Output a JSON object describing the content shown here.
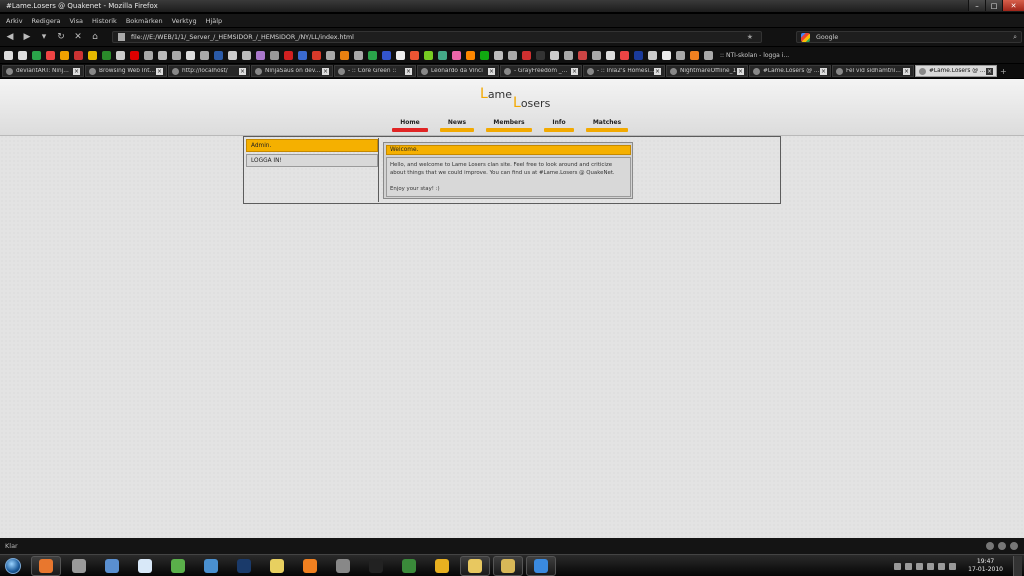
{
  "window": {
    "title": "#Lame.Losers @ Quakenet - Mozilla Firefox"
  },
  "menu": [
    "Arkiv",
    "Redigera",
    "Visa",
    "Historik",
    "Bokmärken",
    "Verktyg",
    "Hjälp"
  ],
  "navbar": {
    "url": "file:///E:/WEB/1/1/_Server_/_HEMSIDOR_/_HEMSIDOR_/NY/LL/index.html",
    "search_placeholder": "Google"
  },
  "bookmarks": {
    "colors": [
      "#ddd",
      "#ddd",
      "#2aa44a",
      "#e44",
      "#f0a000",
      "#c33",
      "#e6b800",
      "#2a8a2a",
      "#ccc",
      "#d00",
      "#aaa",
      "#bbb",
      "#aaa",
      "#ddd",
      "#aaa",
      "#2a5aa8",
      "#ccc",
      "#bbb",
      "#a7c",
      "#999",
      "#d02020",
      "#3a6ad0",
      "#d83a2a",
      "#aaa",
      "#e88010",
      "#aaa",
      "#2aa44a",
      "#3355cc",
      "#eee",
      "#e53",
      "#7c2",
      "#4a8",
      "#e6a",
      "#f80",
      "#1a1",
      "#bbb",
      "#aaa",
      "#d03030",
      "#333",
      "#ccc",
      "#aaa",
      "#c44",
      "#aaa",
      "#ddd",
      "#ee4444",
      "#1a3a9a",
      "#ccc",
      "#eee",
      "#aaa",
      "#f08020",
      "#aaa"
    ],
    "last_label": ":: NTI-skolan - logga i..."
  },
  "tabs": [
    {
      "label": "deviantART: Ninj...",
      "active": false
    },
    {
      "label": "Browsing Web Int...",
      "active": false
    },
    {
      "label": "http://localhost/",
      "active": false
    },
    {
      "label": "NinjaSaus on dev...",
      "active": false
    },
    {
      "label": "- :: Core Green ::",
      "active": false
    },
    {
      "label": "Leonardo da Vinci",
      "active": false
    },
    {
      "label": "- GrayFreedom _...",
      "active": false
    },
    {
      "label": "- :: Inla2's Homesi...",
      "active": false
    },
    {
      "label": "NightmareOffline_1",
      "active": false
    },
    {
      "label": "#Lame.Losers @ ...",
      "active": false
    },
    {
      "label": "Fel vid sidhämtni...",
      "active": false
    },
    {
      "label": "#Lame.Losers @ ...",
      "active": true
    }
  ],
  "site": {
    "logo": {
      "cap1": "L",
      "word1": "ame",
      "cap2": "L",
      "word2": "osers"
    },
    "nav": [
      {
        "label": "Home",
        "active": true
      },
      {
        "label": "News",
        "active": false
      },
      {
        "label": "Members",
        "active": false
      },
      {
        "label": "Info",
        "active": false
      },
      {
        "label": "Matches",
        "active": false
      }
    ],
    "sidebar": {
      "header": "Admin.",
      "login": "LOGGA IN!"
    },
    "welcome": {
      "title": "Welcome.",
      "paragraph1": "Hello, and welcome to Lame Losers clan site. Feel free to look around and criticize about things that we could improve. You can find us at #Lame.Losers @ QuakeNet.",
      "paragraph2": "Enjoy your stay! :)"
    }
  },
  "status": {
    "text": "Klar"
  },
  "taskbar": {
    "items": [
      {
        "name": "firefox-icon",
        "color": "#e8772e",
        "pinned": true
      },
      {
        "name": "alien-icon",
        "color": "#9a9a9a",
        "pinned": false
      },
      {
        "name": "window-icon",
        "color": "#5a8fd0",
        "pinned": false
      },
      {
        "name": "document-icon",
        "color": "#d8e8f8",
        "pinned": false
      },
      {
        "name": "users-icon",
        "color": "#5ab04a",
        "pinned": false
      },
      {
        "name": "notepad-icon",
        "color": "#4a90d0",
        "pinned": false
      },
      {
        "name": "photoshop-icon",
        "color": "#1a3a6a",
        "pinned": false
      },
      {
        "name": "honeycomb-icon",
        "color": "#e8d060",
        "pinned": false
      },
      {
        "name": "blender-icon",
        "color": "#f08020",
        "pinned": false
      },
      {
        "name": "shield-icon",
        "color": "#888",
        "pinned": false
      },
      {
        "name": "steam-icon",
        "color": "#222",
        "pinned": false
      },
      {
        "name": "rockband-icon",
        "color": "#3a8a3a",
        "pinned": false
      },
      {
        "name": "game-icon",
        "color": "#e8b020",
        "pinned": false
      },
      {
        "name": "folder-icon",
        "color": "#e8c860",
        "pinned": true
      },
      {
        "name": "explorer-icon",
        "color": "#d8b858",
        "pinned": true
      },
      {
        "name": "media-player-icon",
        "color": "#3a8ae0",
        "pinned": true
      }
    ],
    "clock_time": "19:47",
    "clock_date": "17-01-2010"
  }
}
